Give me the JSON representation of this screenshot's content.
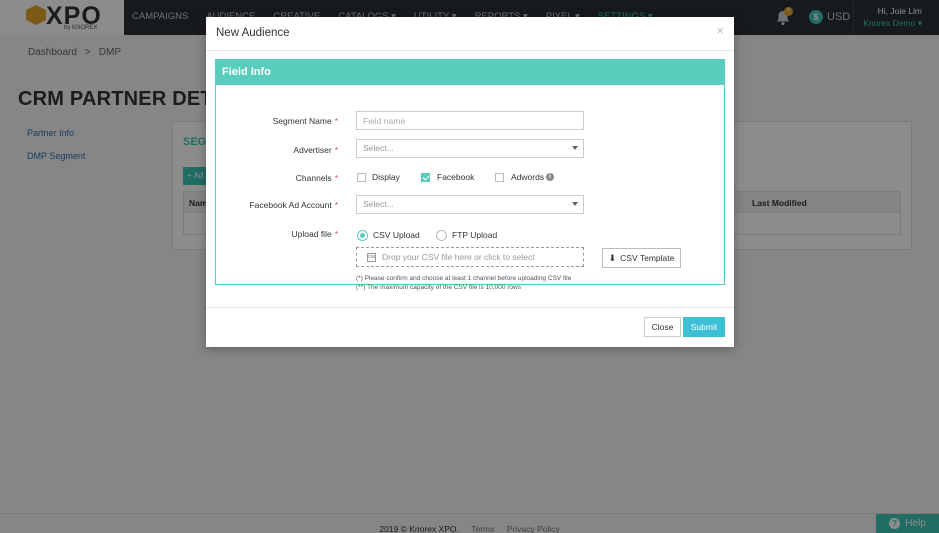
{
  "header": {
    "logo": "XPO",
    "logo_sub": "by KNOREX",
    "nav": [
      "CAMPAIGNS",
      "AUDIENCE",
      "CREATIVE",
      "CATALOGS ▾",
      "UTILITY ▾",
      "REPORTS ▾",
      "PIXEL ▾",
      "SETTINGS ▾"
    ],
    "notifications_count": "0",
    "currency": "USD",
    "user_greeting": "Hi, Joie Lim",
    "user_org": "Knorex Demo ▾"
  },
  "breadcrumb": {
    "items": [
      "Dashboard",
      "DMP"
    ],
    "sep": ">"
  },
  "page": {
    "title": "CRM PARTNER DETAIL",
    "sidebar": [
      "Partner Info",
      "DMP Segment"
    ],
    "panel_heading": "SEGM",
    "add_label": "+ Ad",
    "table_name_col": "Nam",
    "table_modified_col": "Last Modified"
  },
  "modal": {
    "title": "New Audience",
    "close_glyph": "×",
    "section": "Field Info",
    "segment_name": {
      "label": "Segment Name",
      "placeholder": "Field name"
    },
    "advertiser": {
      "label": "Advertiser",
      "value": "Select..."
    },
    "channels": {
      "label": "Channels",
      "options": [
        {
          "label": "Display",
          "checked": false
        },
        {
          "label": "Facebook",
          "checked": true
        },
        {
          "label": "Adwords",
          "checked": false
        }
      ],
      "info_glyph": "i"
    },
    "fb_account": {
      "label": "Facebook Ad Account",
      "value": "Select..."
    },
    "upload": {
      "label": "Upload file",
      "options": [
        "CSV Upload",
        "FTP Upload"
      ],
      "selected": "CSV Upload",
      "drop_text": "Drop your CSV file here or click to select",
      "template_btn": "CSV Template",
      "notes": [
        "(*) Please confirm and choose at least 1 channel before uploading CSV file",
        "(**) The maximum capacity of the CSV file is 10,000 rows"
      ]
    },
    "required_mark": "*",
    "close_btn": "Close",
    "submit_btn": "Submit"
  },
  "footer": {
    "copyright": "2019 © Knorex XPO.",
    "links": [
      "Terms",
      "Privacy Policy"
    ]
  },
  "help": "Help"
}
